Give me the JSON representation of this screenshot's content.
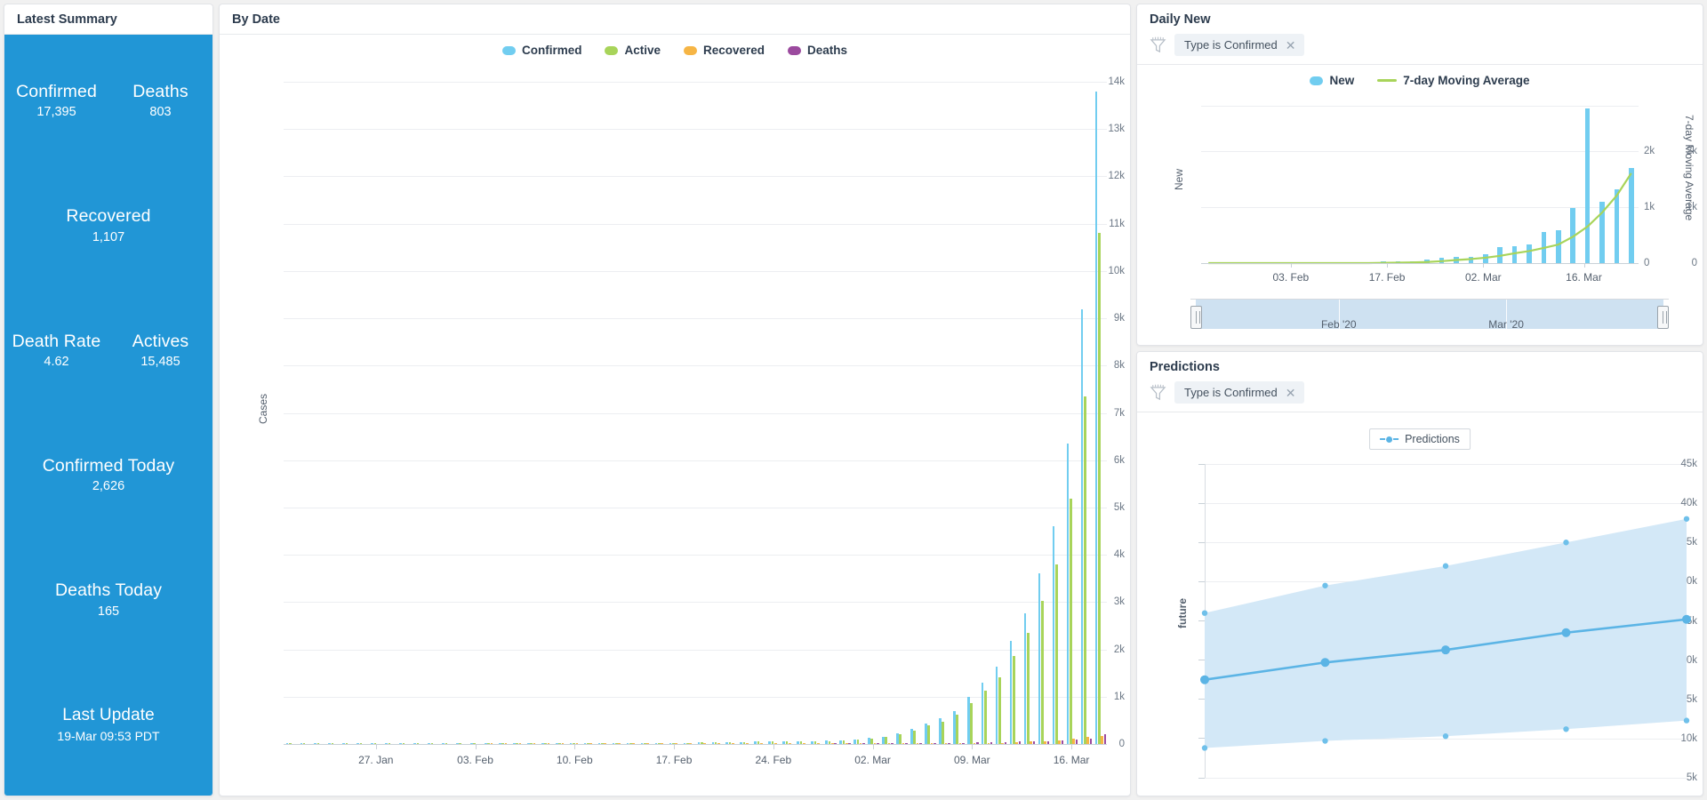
{
  "summary": {
    "title": "Latest Summary",
    "accent": "#2196d6",
    "rows": [
      [
        {
          "label": "Confirmed",
          "value": "17,395"
        },
        {
          "label": "Deaths",
          "value": "803"
        }
      ],
      [
        {
          "label": "Recovered",
          "value": "1,107"
        }
      ],
      [
        {
          "label": "Death Rate",
          "value": "4.62"
        },
        {
          "label": "Actives",
          "value": "15,485"
        }
      ],
      [
        {
          "label": "Confirmed Today",
          "value": "2,626"
        }
      ],
      [
        {
          "label": "Deaths Today",
          "value": "165"
        }
      ],
      [
        {
          "label": "Last Update",
          "value": "19-Mar 09:53 PDT"
        }
      ]
    ]
  },
  "bydate": {
    "title": "By Date",
    "legend": [
      {
        "label": "Confirmed",
        "color": "#71cdf0"
      },
      {
        "label": "Active",
        "color": "#a8d45a"
      },
      {
        "label": "Recovered",
        "color": "#f6b545"
      },
      {
        "label": "Deaths",
        "color": "#9b4a9e"
      }
    ]
  },
  "dailynew": {
    "title": "Daily New",
    "filter": {
      "icon": "funnel-icon",
      "label": "Type is Confirmed",
      "remove": "✕"
    },
    "legend": [
      {
        "label": "New",
        "color": "#71cdf0",
        "shape": "swatch"
      },
      {
        "label": "7-day Moving Average",
        "color": "#a8d45a",
        "shape": "line"
      }
    ],
    "slider": {
      "left_label": "Feb '20",
      "right_label": "Mar '20"
    }
  },
  "predictions": {
    "title": "Predictions",
    "filter": {
      "icon": "funnel-icon",
      "label": "Type is Confirmed",
      "remove": "✕"
    },
    "legend_label": "Predictions"
  },
  "chart_data": [
    {
      "id": "by-date",
      "type": "bar",
      "title": "By Date",
      "xlabel": "",
      "ylabel": "Cases",
      "ylim": [
        0,
        14000
      ],
      "ytick_labels": [
        "0",
        "1k",
        "2k",
        "3k",
        "4k",
        "5k",
        "6k",
        "7k",
        "8k",
        "9k",
        "10k",
        "11k",
        "12k",
        "13k",
        "14k"
      ],
      "ytick_values": [
        0,
        1000,
        2000,
        3000,
        4000,
        5000,
        6000,
        7000,
        8000,
        9000,
        10000,
        11000,
        12000,
        13000,
        14000
      ],
      "xtick_labels": [
        "27. Jan",
        "03. Feb",
        "10. Feb",
        "17. Feb",
        "24. Feb",
        "02. Mar",
        "09. Mar",
        "16. Mar"
      ],
      "xtick_positions": [
        6,
        13,
        20,
        27,
        34,
        41,
        48,
        55
      ],
      "x_range": [
        "22. Jan",
        "19. Mar"
      ],
      "grid": true,
      "legend_position": "top-center",
      "categories": [
        "22.Jan",
        "23.Jan",
        "24.Jan",
        "25.Jan",
        "26.Jan",
        "27.Jan",
        "28.Jan",
        "29.Jan",
        "30.Jan",
        "31.Jan",
        "01.Feb",
        "02.Feb",
        "03.Feb",
        "04.Feb",
        "05.Feb",
        "06.Feb",
        "07.Feb",
        "08.Feb",
        "09.Feb",
        "10.Feb",
        "11.Feb",
        "12.Feb",
        "13.Feb",
        "14.Feb",
        "15.Feb",
        "16.Feb",
        "17.Feb",
        "18.Feb",
        "19.Feb",
        "20.Feb",
        "21.Feb",
        "22.Feb",
        "23.Feb",
        "24.Feb",
        "25.Feb",
        "26.Feb",
        "27.Feb",
        "28.Feb",
        "29.Feb",
        "01.Mar",
        "02.Mar",
        "03.Mar",
        "04.Mar",
        "05.Mar",
        "06.Mar",
        "07.Mar",
        "08.Mar",
        "09.Mar",
        "10.Mar",
        "11.Mar",
        "12.Mar",
        "13.Mar",
        "14.Mar",
        "15.Mar",
        "16.Mar",
        "17.Mar",
        "18.Mar",
        "19.Mar"
      ],
      "series": [
        {
          "name": "Confirmed",
          "color": "#71cdf0",
          "values": [
            1,
            1,
            2,
            2,
            5,
            5,
            5,
            6,
            6,
            8,
            8,
            11,
            11,
            11,
            12,
            12,
            12,
            12,
            12,
            12,
            13,
            13,
            15,
            15,
            15,
            15,
            15,
            25,
            25,
            35,
            35,
            35,
            35,
            53,
            57,
            60,
            60,
            63,
            68,
            75,
            100,
            124,
            158,
            221,
            319,
            435,
            541,
            704,
            994,
            1301,
            1630,
            2183,
            2770,
            3613,
            4596,
            6344,
            9197,
            13789
          ]
        },
        {
          "name": "Active",
          "color": "#a8d45a",
          "values": [
            1,
            1,
            2,
            2,
            5,
            5,
            5,
            6,
            6,
            8,
            8,
            11,
            11,
            11,
            9,
            9,
            9,
            9,
            9,
            9,
            10,
            10,
            12,
            12,
            12,
            12,
            12,
            22,
            22,
            32,
            32,
            32,
            32,
            50,
            54,
            57,
            57,
            59,
            63,
            69,
            92,
            113,
            143,
            199,
            286,
            389,
            479,
            617,
            868,
            1131,
            1405,
            1868,
            2348,
            3017,
            3795,
            5185,
            7349,
            10807
          ]
        },
        {
          "name": "Recovered",
          "color": "#f6b545",
          "values": [
            0,
            0,
            0,
            0,
            0,
            0,
            0,
            0,
            0,
            0,
            0,
            0,
            0,
            0,
            3,
            3,
            3,
            3,
            3,
            3,
            3,
            3,
            3,
            3,
            3,
            3,
            3,
            3,
            3,
            3,
            5,
            5,
            5,
            6,
            6,
            6,
            6,
            7,
            7,
            7,
            7,
            8,
            11,
            12,
            12,
            17,
            17,
            17,
            17,
            23,
            24,
            31,
            49,
            56,
            68,
            106,
            147,
            171
          ]
        },
        {
          "name": "Deaths",
          "color": "#9b4a9e",
          "values": [
            0,
            0,
            0,
            0,
            0,
            0,
            0,
            0,
            0,
            0,
            0,
            0,
            0,
            0,
            0,
            0,
            0,
            0,
            0,
            0,
            0,
            0,
            0,
            0,
            0,
            0,
            0,
            0,
            0,
            0,
            0,
            0,
            0,
            0,
            0,
            0,
            0,
            0,
            1,
            2,
            6,
            9,
            11,
            12,
            14,
            19,
            22,
            26,
            31,
            38,
            41,
            48,
            54,
            57,
            68,
            85,
            108,
            200
          ]
        }
      ]
    },
    {
      "id": "daily-new",
      "type": "bar+line",
      "title": "Daily New",
      "xlabel": "",
      "ylabel": "New",
      "y2label": "7-day Moving Average",
      "ylim": [
        0,
        2800
      ],
      "ytick_labels": [
        "0",
        "1k",
        "2k"
      ],
      "ytick_values": [
        0,
        1000,
        2000
      ],
      "y2tick_labels": [
        "0",
        "1k",
        "2k"
      ],
      "xtick_labels": [
        "03. Feb",
        "17. Feb",
        "02. Mar",
        "16. Mar"
      ],
      "grid": true,
      "legend_position": "top-center",
      "categories": [
        "22.Jan",
        "26.Jan",
        "30.Jan",
        "03.Feb",
        "07.Feb",
        "11.Feb",
        "15.Feb",
        "19.Feb",
        "23.Feb",
        "27.Feb",
        "29.Feb",
        "01.Mar",
        "02.Mar",
        "03.Mar",
        "04.Mar",
        "05.Mar",
        "06.Mar",
        "07.Mar",
        "08.Mar",
        "09.Mar",
        "10.Mar",
        "11.Mar",
        "12.Mar",
        "13.Mar",
        "14.Mar",
        "15.Mar",
        "16.Mar",
        "17.Mar",
        "18.Mar",
        "19.Mar"
      ],
      "series": [
        {
          "name": "New",
          "color": "#71cdf0",
          "values": [
            0,
            0,
            0,
            0,
            0,
            0,
            0,
            0,
            0,
            0,
            0,
            0,
            25,
            24,
            34,
            63,
            98,
            116,
            106,
            163,
            290,
            307,
            329,
            553,
            587,
            983,
            2748,
            1087,
            1310,
            1700
          ]
        },
        {
          "name": "7-day Moving Average",
          "color": "#a8d45a",
          "values": [
            0,
            0,
            0,
            0,
            0,
            0,
            0,
            0,
            0,
            0,
            0,
            0,
            5,
            8,
            12,
            20,
            35,
            55,
            72,
            96,
            130,
            175,
            215,
            270,
            330,
            470,
            650,
            900,
            1200,
            1600
          ]
        }
      ]
    },
    {
      "id": "predictions",
      "type": "line",
      "title": "Predictions",
      "xlabel": "",
      "ylabel": "future",
      "ylim": [
        5000,
        45000
      ],
      "ytick_labels": [
        "5k",
        "10k",
        "15k",
        "20k",
        "25k",
        "30k",
        "35k",
        "40k",
        "45k"
      ],
      "ytick_values": [
        5000,
        10000,
        15000,
        20000,
        25000,
        30000,
        35000,
        40000,
        45000
      ],
      "grid": true,
      "legend_position": "top-center",
      "categories": [
        "1",
        "2",
        "3",
        "4",
        "5"
      ],
      "series": [
        {
          "name": "Predictions",
          "color": "#5bb4e5",
          "values": [
            17500,
            19700,
            21300,
            23500,
            25200
          ]
        },
        {
          "name": "Upper bound",
          "color": "#bcdcf0",
          "values": [
            26000,
            29500,
            32000,
            35000,
            38000
          ]
        },
        {
          "name": "Lower bound",
          "color": "#bcdcf0",
          "values": [
            8800,
            9700,
            10300,
            11200,
            12300
          ]
        }
      ]
    }
  ]
}
